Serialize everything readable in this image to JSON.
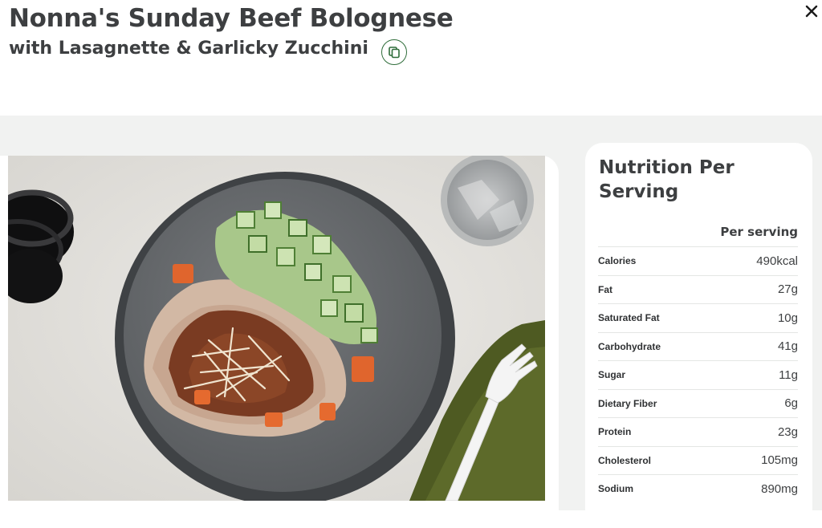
{
  "recipe": {
    "title": "Nonna's Sunday Beef Bolognese",
    "subtitle": "with Lasagnette & Garlicky Zucchini"
  },
  "icons": {
    "copy": "copy-icon",
    "close": "close-icon"
  },
  "colors": {
    "accent_green": "#2f6d3a",
    "background_gray": "#f1f2f1",
    "text_dark": "#3d3f41"
  },
  "nutrition": {
    "title": "Nutrition Per Serving",
    "column_header": "Per serving",
    "rows": [
      {
        "label": "Calories",
        "value": "490kcal"
      },
      {
        "label": "Fat",
        "value": "27g"
      },
      {
        "label": "Saturated Fat",
        "value": "10g"
      },
      {
        "label": "Carbohydrate",
        "value": "41g"
      },
      {
        "label": "Sugar",
        "value": "11g"
      },
      {
        "label": "Dietary Fiber",
        "value": "6g"
      },
      {
        "label": "Protein",
        "value": "23g"
      },
      {
        "label": "Cholesterol",
        "value": "105mg"
      },
      {
        "label": "Sodium",
        "value": "890mg"
      }
    ]
  }
}
